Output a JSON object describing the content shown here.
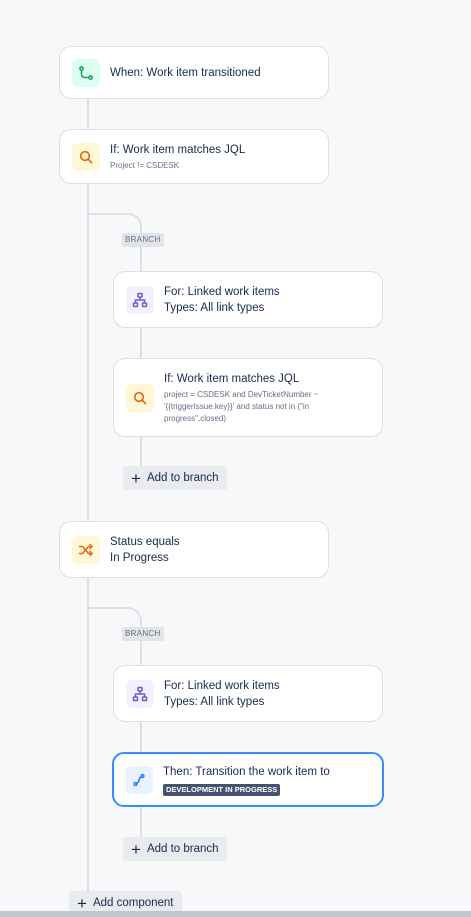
{
  "colors": {
    "trigger_icon_bg": "#dcfff1",
    "trigger_icon_fg": "#22a06b",
    "condition_icon_bg": "#fff7d6",
    "condition_icon_fg": "#e56910",
    "branch_icon_bg": "#f3f0ff",
    "branch_icon_fg": "#6e5dc6",
    "action_icon_bg": "#e9f2ff",
    "action_icon_fg": "#1d7afc",
    "selected_border": "#388bff"
  },
  "trigger": {
    "icon": "flow-icon",
    "title": "When: Work item transitioned"
  },
  "condition1": {
    "icon": "search-icon",
    "title": "If: Work item matches JQL",
    "detail": "Project != CSDESK"
  },
  "branch1": {
    "badge": "BRANCH",
    "for": {
      "icon": "hierarchy-icon",
      "title": "For: Linked work items",
      "subtitle": "Types: All link types"
    },
    "condition": {
      "icon": "search-icon",
      "title": "If: Work item matches JQL",
      "detail_line1": "project = CSDESK and DevTicketNumber ~",
      "detail_line2": "'{{triggerIssue.key}}' and status not in (\"in",
      "detail_line3": "progress\",closed)"
    },
    "add_label": "Add to branch"
  },
  "condition2": {
    "icon": "shuffle-icon",
    "title": "Status equals",
    "subtitle": "In Progress"
  },
  "branch2": {
    "badge": "BRANCH",
    "for": {
      "icon": "hierarchy-icon",
      "title": "For: Linked work items",
      "subtitle": "Types: All link types"
    },
    "action": {
      "icon": "transition-icon",
      "title": "Then: Transition the work item to",
      "status": "DEVELOPMENT IN PROGRESS"
    },
    "add_label": "Add to branch"
  },
  "add_component_label": "Add component"
}
